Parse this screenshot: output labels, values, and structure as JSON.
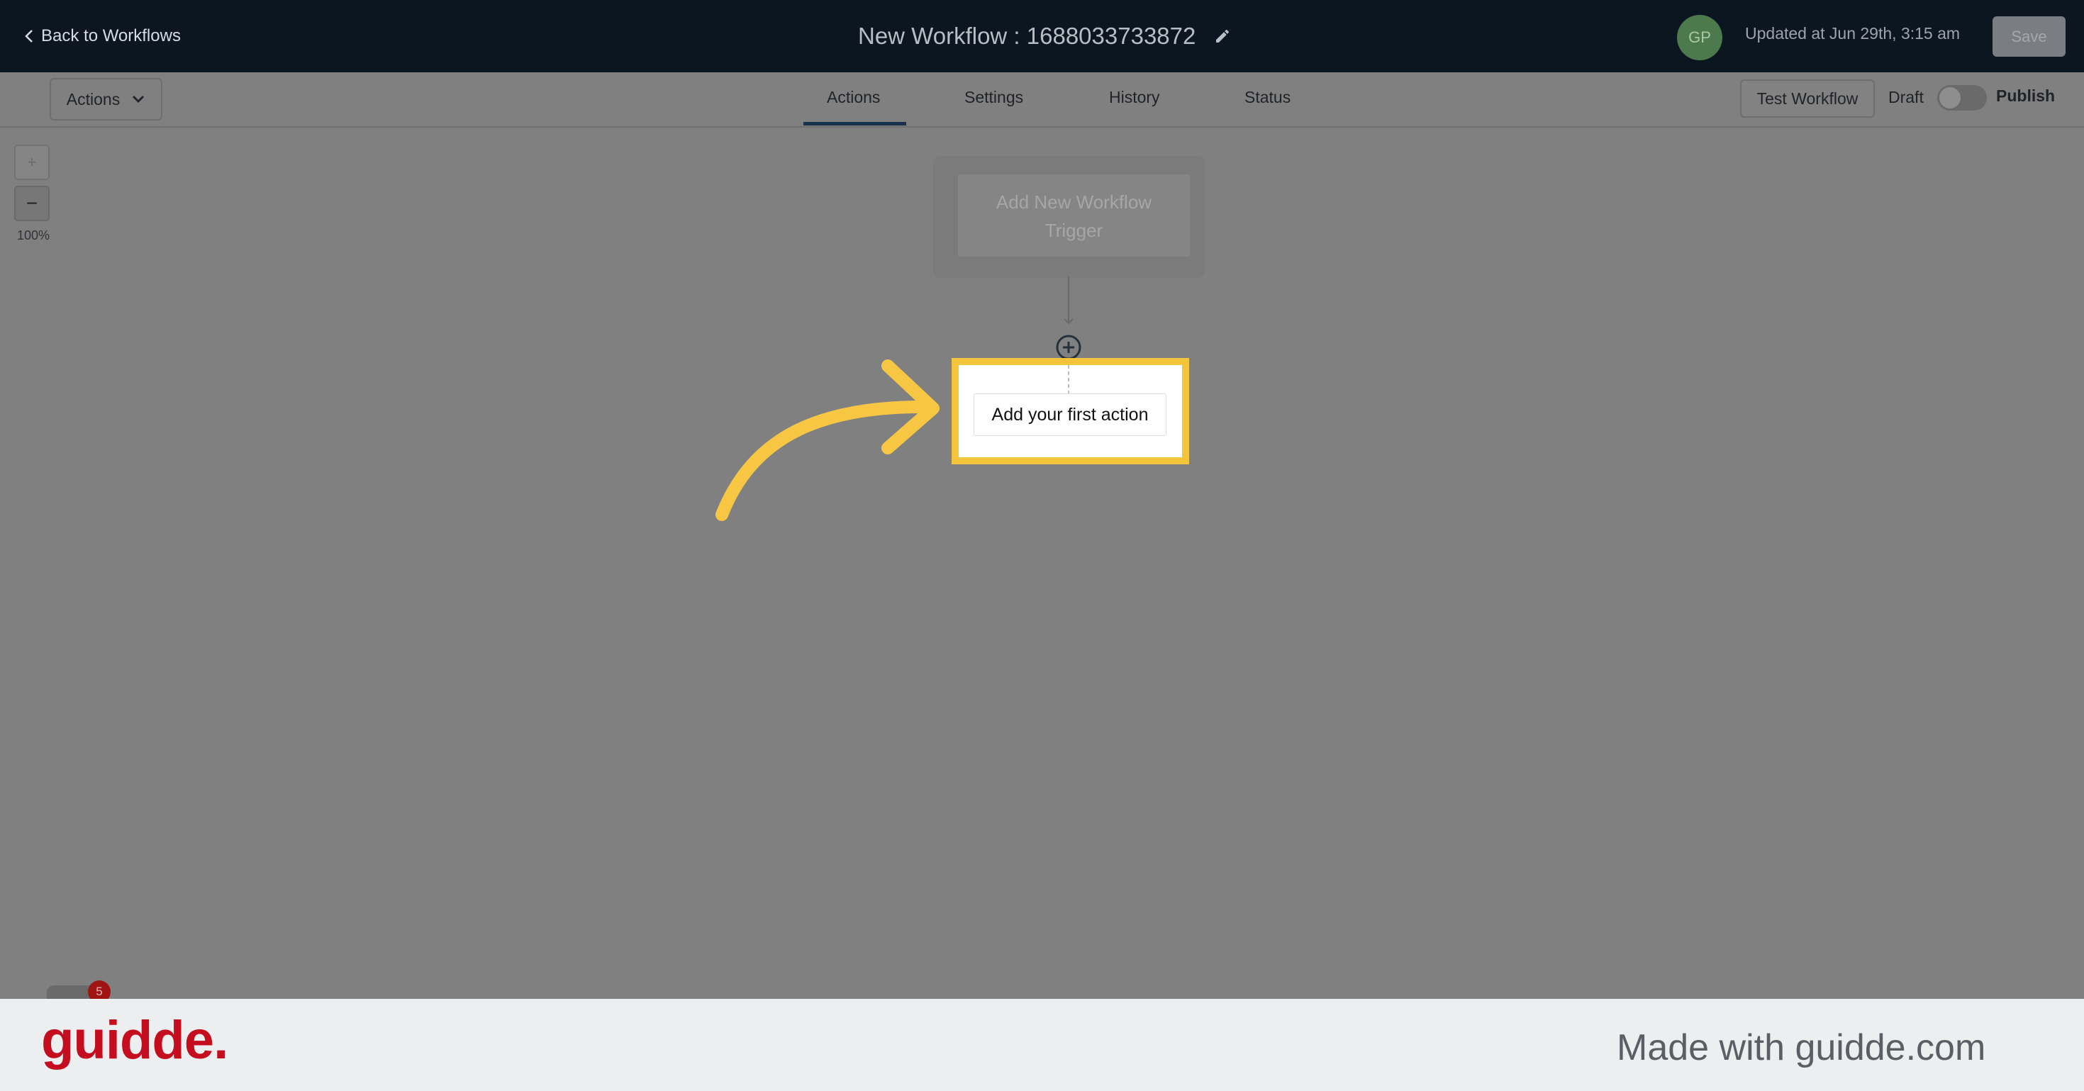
{
  "header": {
    "back_label": "Back to Workflows",
    "title": "New Workflow : 1688033733872",
    "avatar_initials": "GP",
    "updated_text": "Updated at Jun 29th, 3:15 am",
    "save_label": "Save"
  },
  "toolbar": {
    "actions_dropdown_label": "Actions",
    "tabs": [
      {
        "label": "Actions",
        "active": true
      },
      {
        "label": "Settings",
        "active": false
      },
      {
        "label": "History",
        "active": false
      },
      {
        "label": "Status",
        "active": false
      }
    ],
    "test_workflow_label": "Test Workflow",
    "draft_label": "Draft",
    "publish_label": "Publish"
  },
  "zoom": {
    "in_label": "+",
    "out_label": "−",
    "level": "100%"
  },
  "canvas": {
    "trigger_label_line1": "Add New Workflow",
    "trigger_label_line2": "Trigger",
    "first_action_label": "Add your first action"
  },
  "notifications": {
    "count": "5"
  },
  "footer": {
    "logo_text": "guidde.",
    "made_with_text": "Made with guidde.com"
  },
  "colors": {
    "header_bg": "#0b1620",
    "highlight": "#f5c43d",
    "brand_red": "#c40d1e"
  }
}
